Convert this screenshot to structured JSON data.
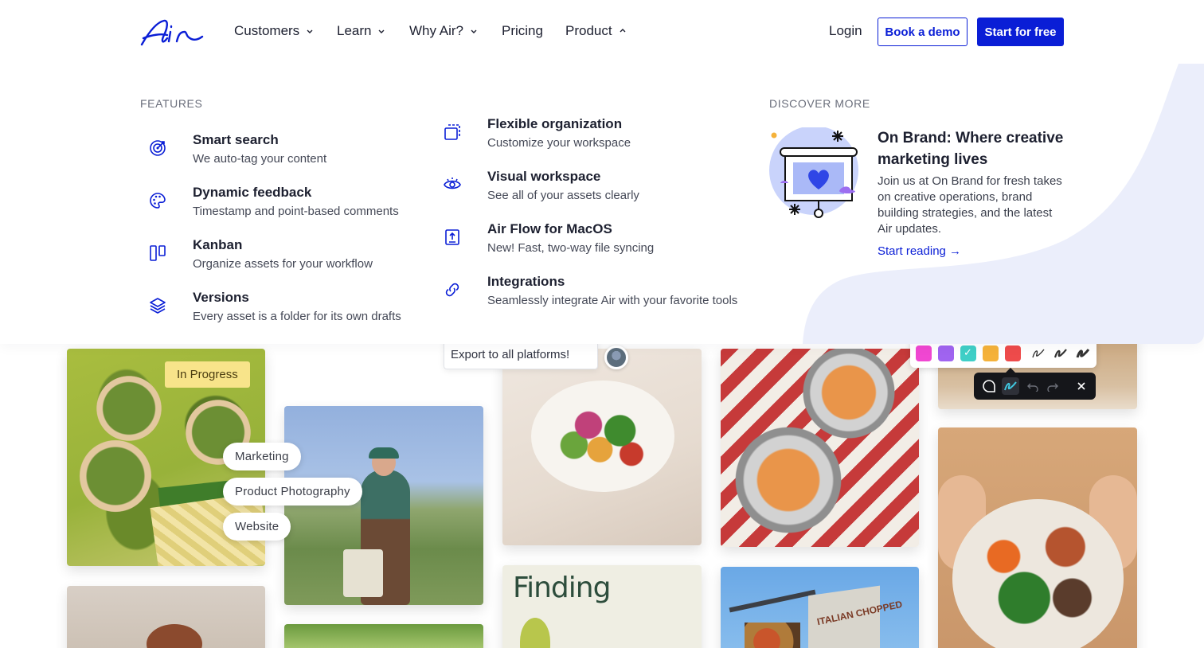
{
  "nav": {
    "items": [
      {
        "label": "Customers",
        "chevron": "down"
      },
      {
        "label": "Learn",
        "chevron": "down"
      },
      {
        "label": "Why Air?",
        "chevron": "down"
      },
      {
        "label": "Pricing",
        "chevron": ""
      },
      {
        "label": "Product",
        "chevron": "up"
      }
    ],
    "login": "Login",
    "demo_label": "Book a demo",
    "free_label": "Start for free"
  },
  "menu": {
    "features_label": "FEATURES",
    "features_left": [
      {
        "title": "Smart search",
        "desc": "We auto-tag your content",
        "icon": "target-icon"
      },
      {
        "title": "Dynamic feedback",
        "desc": "Timestamp and point-based comments",
        "icon": "palette-icon"
      },
      {
        "title": "Kanban",
        "desc": "Organize assets for your workflow",
        "icon": "kanban-icon"
      },
      {
        "title": "Versions",
        "desc": "Every asset is a folder for its own drafts",
        "icon": "layers-icon"
      }
    ],
    "features_right": [
      {
        "title": "Flexible organization",
        "desc": "Customize your workspace",
        "icon": "folders-icon"
      },
      {
        "title": "Visual workspace",
        "desc": "See all of your assets clearly",
        "icon": "eye-icon"
      },
      {
        "title": "Air Flow for MacOS",
        "desc": "New! Fast, two-way file syncing",
        "icon": "upload-icon"
      },
      {
        "title": "Integrations",
        "desc": "Seamlessly integrate Air with your favorite tools",
        "icon": "link-icon"
      }
    ],
    "discover_label": "DISCOVER MORE",
    "discover": {
      "title": "On Brand: Where creative marketing lives",
      "desc": "Join us at On Brand for fresh takes on creative operations, brand building strategies, and the latest Air updates.",
      "link": "Start reading →"
    }
  },
  "gallery": {
    "status_tag": "In Progress",
    "tags": [
      "Marketing",
      "Product Photography",
      "Website"
    ],
    "comment": "Export to all platforms!",
    "card_title": "Finding",
    "billboard_text": "ITALIAN CHOPPED",
    "palette_colors": [
      "#f047d2",
      "#a064f0",
      "#3fcfc7",
      "#f5b23a",
      "#ee4b4b"
    ]
  },
  "colors": {
    "brand": "#0a1ed6",
    "accent_bg": "#ebeefb"
  }
}
